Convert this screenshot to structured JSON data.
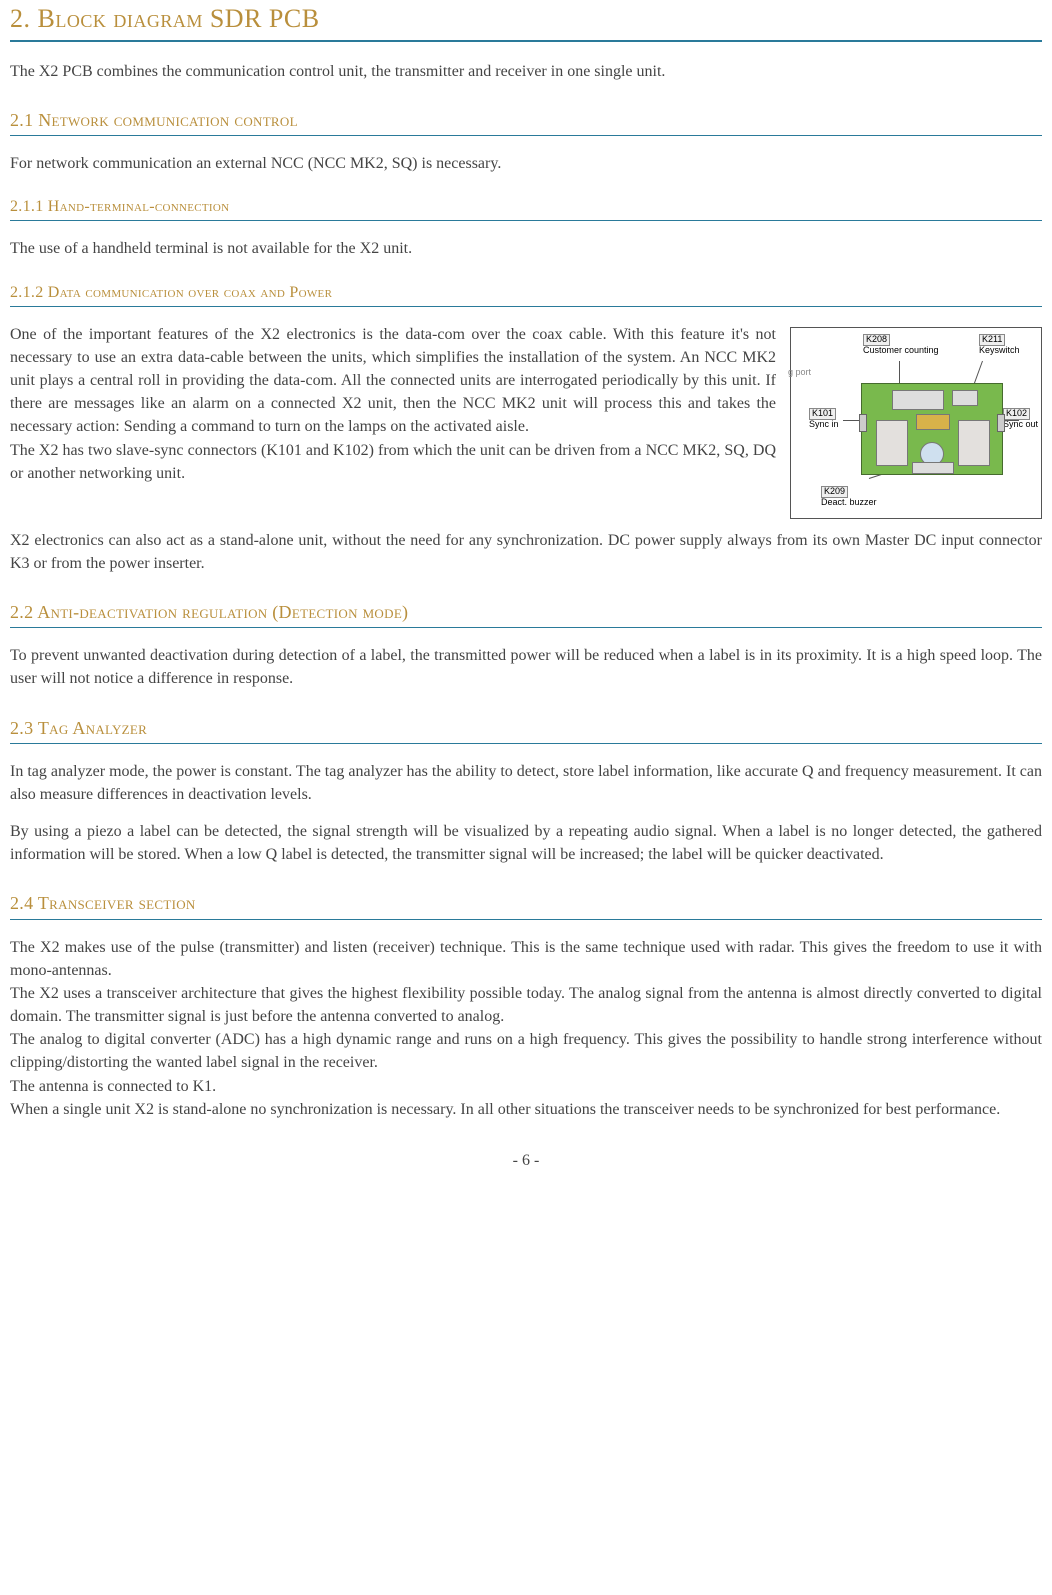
{
  "h1": "2. Block diagram SDR  PCB",
  "p_intro": "The X2 PCB combines the communication control unit, the transmitter and receiver in one single unit.",
  "h2_1": "2.1 Network communication control",
  "p_2_1": "For network communication an external NCC  (NCC MK2, SQ) is necessary.",
  "h3_1_1": "2.1.1 Hand-terminal-connection",
  "p_2_1_1": "The use of a handheld terminal is not available for the X2 unit.",
  "h3_1_2": "2.1.2 Data communication over coax and Power",
  "fig": {
    "k208": "K208",
    "k208_sub": "Customer counting",
    "k211": "K211",
    "k211_sub": "Keyswitch",
    "k101": "K101",
    "k101_sub": "Sync in",
    "k102": "K102",
    "k102_sub": "Sync out",
    "k209": "K209",
    "k209_sub": "Deact. buzzer",
    "port": "g port"
  },
  "p_2_1_2a": "One of the important features of the X2 electronics is the data-com over the coax cable. With this feature it's not necessary to use an extra data-cable between the units, which simplifies the installation of the system. An NCC MK2 unit plays a central roll in providing the data-com. All the connected units are interrogated periodically by this unit. If there are messages like an alarm on a connected X2 unit, then the NCC MK2 unit will process this and takes the necessary action: Sending a command to turn on the lamps on the activated aisle.",
  "p_2_1_2b": "The X2 has two slave-sync connectors (K101 and K102) from which the unit can be driven from a NCC MK2, SQ, DQ or another networking unit.",
  "p_2_1_2c": "X2 electronics can also act as a stand-alone unit, without the need for any synchronization. DC power supply always from its own Master DC input connector K3 or from the power inserter.",
  "h2_2": "2.2 Anti-deactivation regulation (Detection mode)",
  "p_2_2": "To prevent unwanted deactivation during detection of a label, the transmitted power will be reduced when a label is in its proximity. It is a high speed loop. The user will not notice a difference in response.",
  "h2_3": "2.3 Tag Analyzer",
  "p_2_3a": "In tag analyzer mode, the power is constant. The tag analyzer has the ability to detect, store label information, like accurate Q and frequency measurement. It can also measure differences in deactivation levels.",
  "p_2_3b": "By using a piezo a label can be detected, the signal strength will be visualized by a repeating audio signal.  When a label is no longer detected, the gathered information will be stored. When a low Q label is detected, the transmitter signal will be increased; the label will be quicker deactivated.",
  "h2_4": "2.4 Transceiver section",
  "p_2_4a": "The X2 makes use of the pulse (transmitter) and listen (receiver) technique. This is the same technique used with radar. This gives the freedom to use it with mono-antennas.",
  "p_2_4b": "The X2 uses a transceiver architecture that gives the highest flexibility possible today. The analog signal from the antenna is almost directly converted to digital domain. The transmitter signal is just before the antenna converted to analog.",
  "p_2_4c": "The analog to digital converter (ADC) has a high dynamic range and runs on a high frequency. This gives the possibility to handle strong interference without clipping/distorting the wanted label signal in the receiver.",
  "p_2_4d": "The antenna is connected to K1.",
  "p_2_4e": "When a single unit X2 is stand-alone no synchronization is necessary. In all other situations the transceiver needs to be synchronized for best performance.",
  "page_num": "- 6 -"
}
